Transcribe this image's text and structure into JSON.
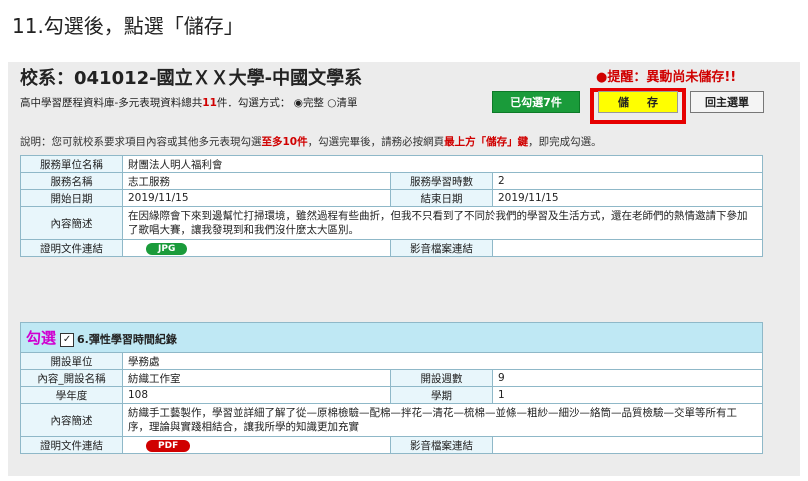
{
  "step_title": "11.勾選後，點選「儲存」",
  "header": {
    "dept_title": "校系：041012-國立ＸＸ大學-中國文學系",
    "reminder": "●提醒：異動尚未儲存!!",
    "subinfo_prefix": "高中學習歷程資料庫-多元表現資料總共",
    "subinfo_count": "11",
    "subinfo_suffix": "件．勾選方式：",
    "option_full": "完整",
    "option_list": "清單",
    "btn_checked": "已勾選7件",
    "btn_save": "儲存",
    "btn_menu": "回主選單"
  },
  "note": {
    "p1": "說明：您可就校系要求項目內容或其他多元表現勾選",
    "r1": "至多10件",
    "p2": "，勾選完畢後，請務必按網頁",
    "r2": "最上方「儲存」鍵",
    "p3": "，即完成勾選。"
  },
  "record1": {
    "unit_label": "服務單位名稱",
    "unit_value": "財團法人明人福利會",
    "name_label": "服務名稱",
    "name_value": "志工服務",
    "hours_label": "服務學習時數",
    "hours_value": "2",
    "start_label": "開始日期",
    "start_value": "2019/11/15",
    "end_label": "結束日期",
    "end_value": "2019/11/15",
    "desc_label": "內容簡述",
    "desc_value": "在因緣際會下來到邊幫忙打掃環境，雖然過程有些曲折，但我不只看到了不同於我們的學習及生活方式，還在老師們的熱情邀請下參加了歌唱大賽，讓我發現到和我們沒什麼太大區別。",
    "proof_label": "證明文件連結",
    "proof_badge": "JPG",
    "media_label": "影音檔案連結"
  },
  "record2": {
    "check_label": "勾選",
    "check_mark": "✓",
    "title": "6.彈性學習時間紀錄",
    "unit_label": "開設單位",
    "unit_value": "學務處",
    "course_label": "內容_開設名稱",
    "course_value": "紡織工作室",
    "weeks_label": "開設週數",
    "weeks_value": "9",
    "year_label": "學年度",
    "year_value": "108",
    "term_label": "學期",
    "term_value": "1",
    "desc_label": "內容簡述",
    "desc_value": "紡織手工藝製作，學習並詳細了解了從—原棉檢驗—配棉—拌花—清花—梳棉—並條—粗紗—細沙—絡筒—品質檢驗—交單等所有工序，理論與實踐相結合，讓我所學的知識更加充實",
    "proof_label": "證明文件連結",
    "proof_badge": "PDF",
    "media_label": "影音檔案連結"
  }
}
